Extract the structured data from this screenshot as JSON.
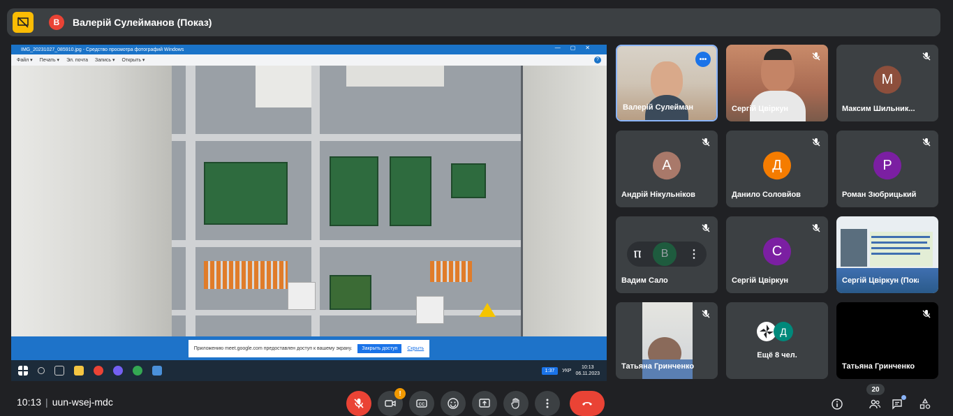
{
  "presenter": {
    "avatar_letter": "В",
    "label": "Валерій Сулейманов (Показ)"
  },
  "shared_window": {
    "title": "IMG_20231027_085910.jpg - Средство просмотра фотографий Windows",
    "menu": [
      "Файл ▾",
      "Печать ▾",
      "Эл. почта",
      "Запись ▾",
      "Открыть ▾"
    ],
    "notification_text": "Приложению meet.google.com предоставлен доступ к вашему экрану.",
    "notification_button": "Закрыть доступ",
    "notification_hide": "Скрыть",
    "taskbar_zoom": "1:37",
    "taskbar_lang": "УКР",
    "taskbar_time": "10:13",
    "taskbar_date": "06.11.2023"
  },
  "participants": [
    {
      "name": "Валерій Сулейман",
      "type": "video",
      "active": true
    },
    {
      "name": "Сергій Цвіркун",
      "type": "video",
      "muted": true
    },
    {
      "name": "Максим Шильник...",
      "type": "avatar",
      "letter": "М",
      "color": "#8d4f3c",
      "muted": true
    },
    {
      "name": "Андрій Нікульніков",
      "type": "avatar",
      "letter": "А",
      "color": "#a9796a",
      "muted": true
    },
    {
      "name": "Данило Соловйов",
      "type": "avatar",
      "letter": "Д",
      "color": "#f57c00",
      "muted": true
    },
    {
      "name": "Роман Зюбрицький",
      "type": "avatar",
      "letter": "Р",
      "color": "#7b1fa2",
      "muted": true
    },
    {
      "name": "Вадим Сало",
      "type": "avatar-hover",
      "letter": "В",
      "color": "#1e5b3e",
      "muted": true
    },
    {
      "name": "Сергій Цвіркун",
      "type": "avatar",
      "letter": "С",
      "color": "#7b1fa2",
      "muted": true
    },
    {
      "name": "Сергій Цвіркун (Показ)",
      "type": "presentation"
    },
    {
      "name": "Татьяна Гринченко",
      "type": "video",
      "muted": true
    },
    {
      "name": "Ещё 8 чел.",
      "type": "more",
      "letter": "Д",
      "color": "#00897b"
    },
    {
      "name": "Татьяна Гринченко",
      "type": "black",
      "muted": true
    }
  ],
  "meeting": {
    "time": "10:13",
    "code": "uun-wsej-mdc",
    "participants_count": "20",
    "raise_badge": "!"
  },
  "colors": {
    "background": "#202124",
    "tile": "#3c4043",
    "danger": "#ea4335",
    "accent": "#8ab4f8",
    "present": "#fbbc04"
  }
}
